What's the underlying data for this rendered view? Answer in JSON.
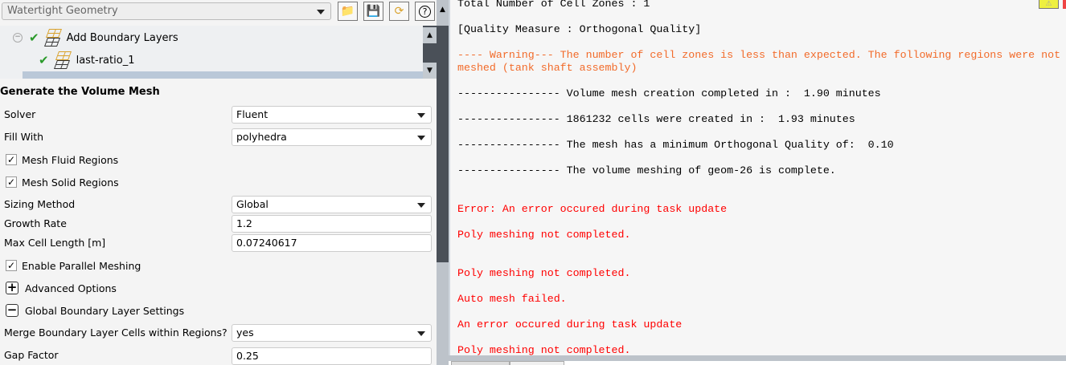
{
  "workflow": {
    "selected": "Watertight Geometry"
  },
  "toolbar": {
    "icons": [
      "open-folder-icon",
      "save-icon",
      "refresh-icon",
      "help-icon"
    ],
    "help_glyph": "?"
  },
  "tree": {
    "items": [
      {
        "label": "Add Boundary Layers",
        "status": "done"
      },
      {
        "label": "last-ratio_1",
        "status": "done"
      }
    ]
  },
  "form": {
    "title": "Generate the Volume Mesh",
    "solver": {
      "label": "Solver",
      "value": "Fluent"
    },
    "fill_with": {
      "label": "Fill With",
      "value": "polyhedra"
    },
    "mesh_fluid": {
      "label": "Mesh Fluid Regions",
      "checked": true
    },
    "mesh_solid": {
      "label": "Mesh Solid Regions",
      "checked": true
    },
    "sizing_method": {
      "label": "Sizing Method",
      "value": "Global"
    },
    "growth_rate": {
      "label": "Growth Rate",
      "value": "1.2"
    },
    "max_cell_length": {
      "label": "Max Cell Length [m]",
      "value": "0.07240617"
    },
    "parallel": {
      "label": "Enable Parallel Meshing",
      "checked": true
    },
    "advanced": {
      "label": "Advanced Options",
      "expanded": false
    },
    "global_bl": {
      "label": "Global Boundary Layer Settings",
      "expanded": true
    },
    "merge_bl": {
      "label": "Merge Boundary Layer Cells within Regions?",
      "value": "yes"
    },
    "gap_factor": {
      "label": "Gap Factor",
      "value": "0.25"
    }
  },
  "console": {
    "lines": [
      "Total Number of Cell Zones : 1",
      "[Quality Measure : Orthogonal Quality]",
      "---- Warning--- The number of cell zones is less than expected. The following regions were not",
      "meshed (tank shaft assembly)",
      "---------------- Volume mesh creation completed in :  1.90 minutes",
      "---------------- 1861232 cells were created in :  1.93 minutes",
      "---------------- The mesh has a minimum Orthogonal Quality of:  0.10",
      "---------------- The volume meshing of geom-26 is complete.",
      "Error: An error occured during task update",
      "Poly meshing not completed.",
      "Poly meshing not completed.",
      "Auto mesh failed.",
      "An error occured during task update",
      "Poly meshing not completed."
    ]
  },
  "colors": {
    "warning": "#f26b2a",
    "error": "#ff0000",
    "check": "#2a9a2a",
    "accent": "#d9a12b"
  }
}
